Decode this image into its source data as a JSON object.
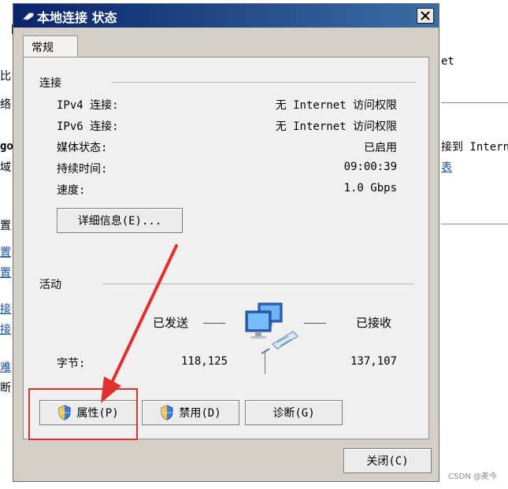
{
  "background": {
    "fragments": [
      {
        "text": "[",
        "style": "plain"
      },
      {
        "text": "比",
        "style": "plain"
      },
      {
        "text": "络",
        "style": "plain"
      },
      {
        "text": "go",
        "style": "bold"
      },
      {
        "text": "域",
        "style": "plain"
      },
      {
        "text": "置",
        "style": "plain"
      },
      {
        "text": "置",
        "style": "link"
      },
      {
        "text": "置",
        "style": "link"
      },
      {
        "text": "接",
        "style": "link"
      },
      {
        "text": "接",
        "style": "link"
      },
      {
        "text": "难",
        "style": "link"
      },
      {
        "text": "断",
        "style": "plain"
      },
      {
        "text": "et",
        "style": "plain"
      },
      {
        "text": "接到 Intern",
        "style": "plain"
      },
      {
        "text": "表",
        "style": "link"
      }
    ]
  },
  "dialog": {
    "title": "本地连接 状态",
    "close_label": "✕",
    "tab_label": "常规",
    "connection": {
      "section_label": "连接",
      "rows": [
        {
          "label": "IPv4 连接:",
          "value": "无 Internet 访问权限"
        },
        {
          "label": "IPv6 连接:",
          "value": "无 Internet 访问权限"
        },
        {
          "label": "媒体状态:",
          "value": "已启用"
        },
        {
          "label": "持续时间:",
          "value": "09:00:39"
        },
        {
          "label": "速度:",
          "value": "1.0 Gbps"
        }
      ],
      "details_button": "详细信息(E)..."
    },
    "activity": {
      "section_label": "活动",
      "sent_label": "已发送",
      "received_label": "已接收",
      "bytes_label": "字节:",
      "bytes_sent": "118,125",
      "bytes_received": "137,107"
    },
    "buttons": {
      "properties": "属性(P)",
      "disable": "禁用(D)",
      "diagnose": "诊断(G)",
      "close": "关闭(C)"
    }
  },
  "watermark": "CSDN @麦今",
  "colors": {
    "titlebar_start": "#0a246a",
    "titlebar_end": "#3a6ea5",
    "annotation": "#e03030",
    "link": "#1a4fa0"
  }
}
